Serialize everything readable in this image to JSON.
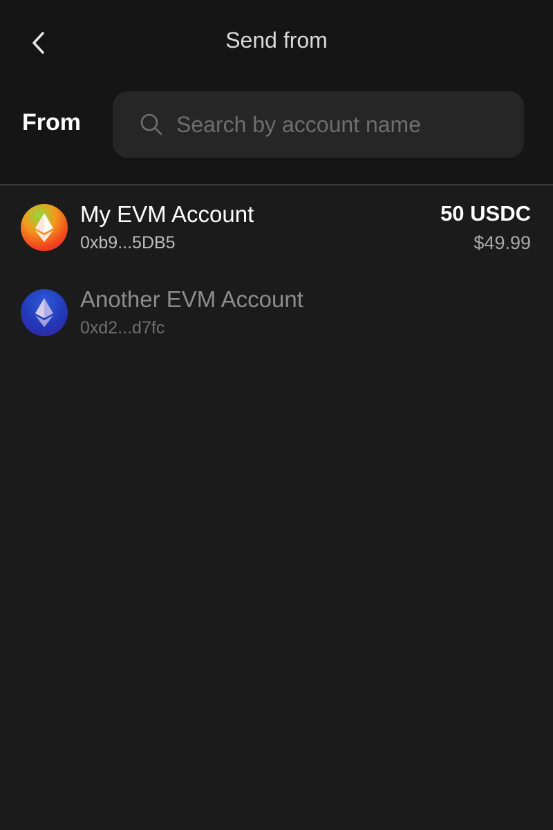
{
  "header": {
    "title": "Send from",
    "back_icon": "chevron-left-icon"
  },
  "from": {
    "label": "From",
    "search": {
      "placeholder": "Search by account name",
      "value": "",
      "icon": "search-icon"
    }
  },
  "accounts": [
    {
      "name": "My EVM Account",
      "address": "0xb9...5DB5",
      "balance": "50 USDC",
      "balance_usd": "$49.99",
      "icon": "ethereum-icon"
    },
    {
      "name": "Another EVM Account",
      "address": "0xd2...d7fc",
      "icon": "ethereum-icon"
    }
  ],
  "colors": {
    "background": "#1b1b1b",
    "header_background": "#151515",
    "search_background": "#262626",
    "divider": "#3a3a3a"
  }
}
